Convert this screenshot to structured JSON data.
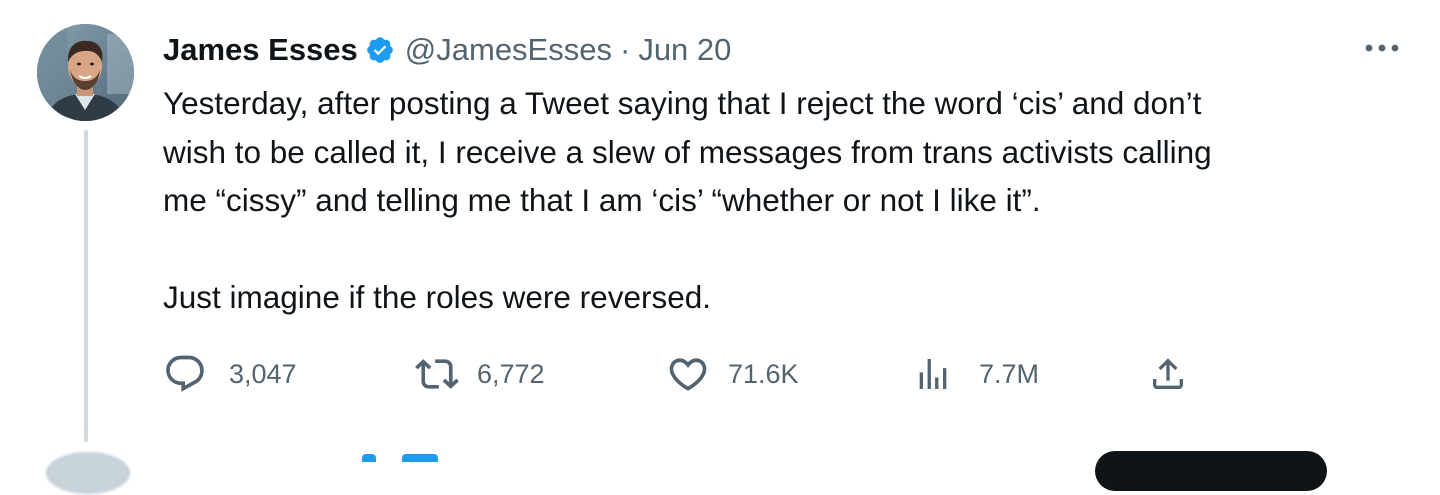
{
  "tweet": {
    "author": {
      "display_name": "James Esses",
      "handle": "@JamesEsses",
      "verified": true
    },
    "separator": "·",
    "date": "Jun 20",
    "text_lines": [
      "Yesterday, after posting a Tweet saying that I reject the word ‘cis’ and don’t",
      "wish to be called it, I receive a slew of messages from trans activists calling",
      "me “cissy” and telling me that I am ‘cis’ “whether or not I like it”."
    ],
    "text_line_2": "Just imagine if the roles were reversed.",
    "stats": {
      "replies": "3,047",
      "retweets": "6,772",
      "likes": "71.6K",
      "views": "7.7M"
    },
    "icons": {
      "more": "more-dots-icon",
      "reply": "reply-bubble-icon",
      "retweet": "retweet-icon",
      "like": "heart-icon",
      "views": "views-bars-icon",
      "share": "share-upload-icon",
      "verified": "verified-badge-icon"
    },
    "colors": {
      "text": "#0f1419",
      "secondary": "#536471",
      "verified": "#1d9bf0",
      "thread_line": "#cfd9de"
    }
  }
}
